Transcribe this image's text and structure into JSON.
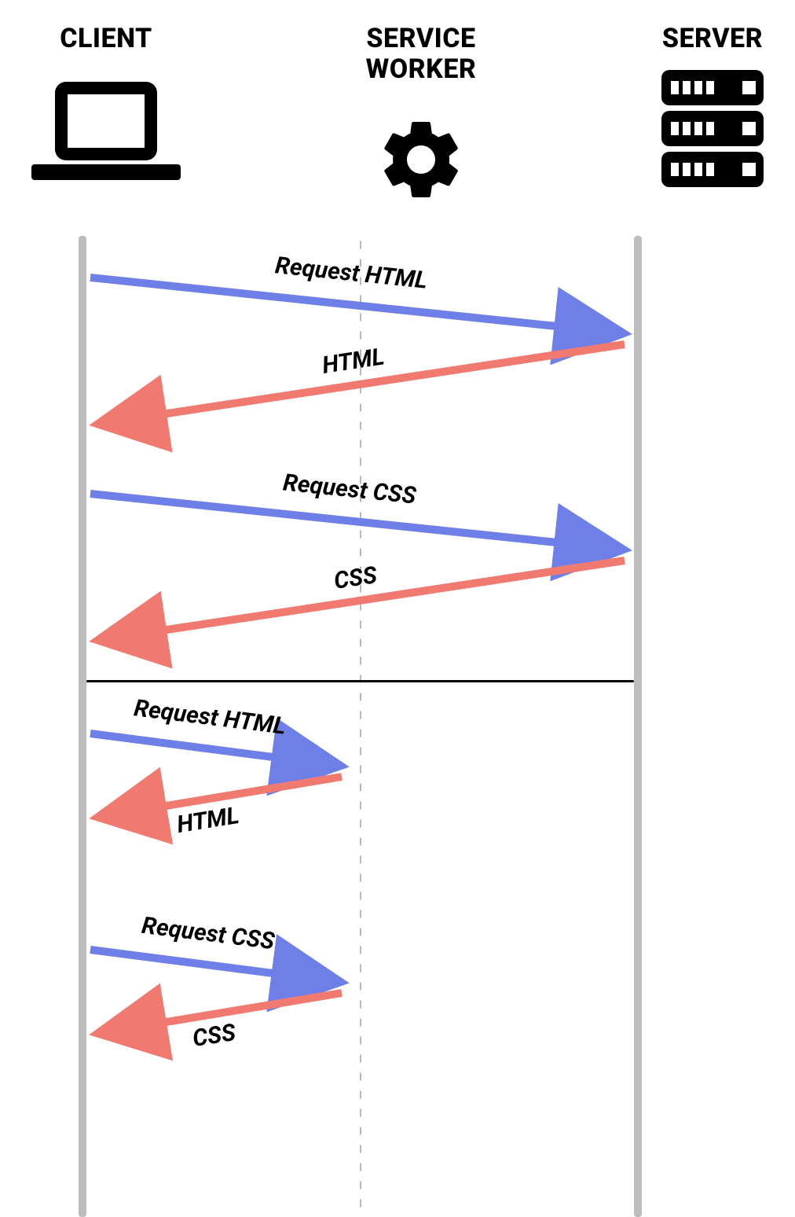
{
  "columns": {
    "client": "CLIENT",
    "service_worker_l1": "SERVICE",
    "service_worker_l2": "WORKER",
    "server": "SERVER"
  },
  "flows": {
    "req_html_1": "Request HTML",
    "resp_html_1": "HTML",
    "req_css_1": "Request CSS",
    "resp_css_1": "CSS",
    "req_html_2": "Request HTML",
    "resp_html_2": "HTML",
    "req_css_2": "Request CSS",
    "resp_css_2": "CSS"
  },
  "colors": {
    "request": "#6E7FE8",
    "response": "#F07A70",
    "lifeline": "#BDBDBD",
    "dot": "#B8B8B8"
  }
}
